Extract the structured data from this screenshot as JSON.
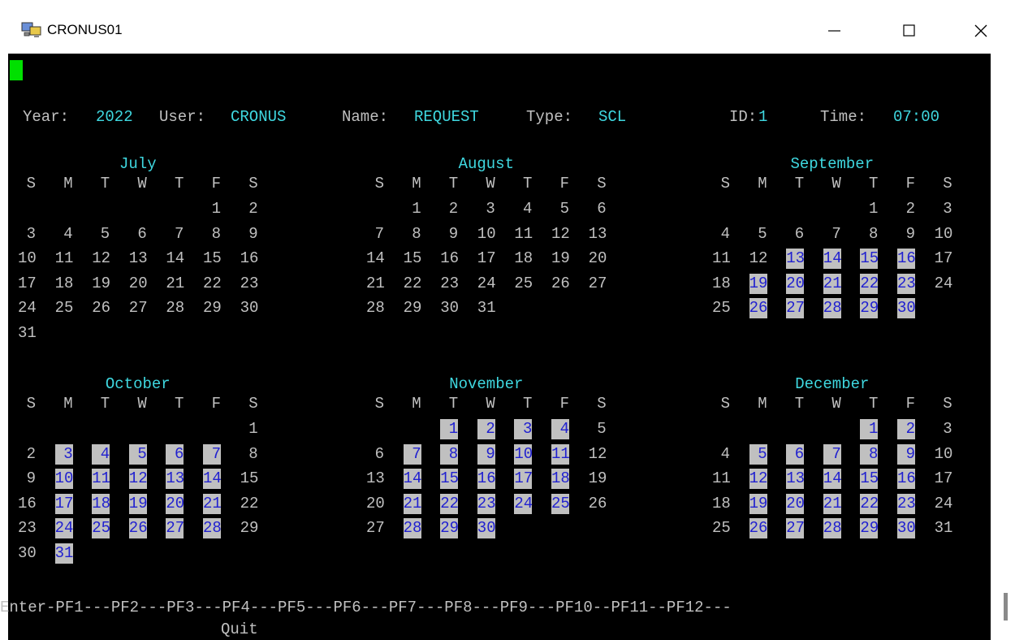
{
  "window": {
    "title": "CRONUS01"
  },
  "header": {
    "year_label": "Year:",
    "year": "2022",
    "user_label": "User:",
    "user": "CRONUS",
    "name_label": "Name:",
    "name": "REQUEST",
    "type_label": "Type:",
    "type": "SCL",
    "id_label": "ID:",
    "id": "1",
    "time_label": "Time:",
    "time": "07:00"
  },
  "weekdays": [
    "S",
    "M",
    "T",
    "W",
    "T",
    "F",
    "S"
  ],
  "months": [
    {
      "name": "July",
      "first_weekday": 5,
      "days": 31,
      "selected": []
    },
    {
      "name": "August",
      "first_weekday": 1,
      "days": 31,
      "selected": []
    },
    {
      "name": "September",
      "first_weekday": 4,
      "days": 30,
      "selected": [
        13,
        14,
        15,
        16,
        19,
        20,
        21,
        22,
        23,
        26,
        27,
        28,
        29,
        30
      ]
    },
    {
      "name": "October",
      "first_weekday": 6,
      "days": 31,
      "selected": [
        3,
        4,
        5,
        6,
        7,
        10,
        11,
        12,
        13,
        14,
        17,
        18,
        19,
        20,
        21,
        24,
        25,
        26,
        27,
        28,
        31
      ]
    },
    {
      "name": "November",
      "first_weekday": 2,
      "days": 30,
      "selected": [
        1,
        2,
        3,
        4,
        7,
        8,
        9,
        10,
        11,
        14,
        15,
        16,
        17,
        18,
        21,
        22,
        23,
        24,
        25,
        28,
        29,
        30
      ]
    },
    {
      "name": "December",
      "first_weekday": 4,
      "days": 31,
      "selected": [
        1,
        2,
        5,
        6,
        7,
        8,
        9,
        12,
        13,
        14,
        15,
        16,
        19,
        20,
        21,
        22,
        23,
        26,
        27,
        28,
        29,
        30
      ]
    }
  ],
  "footer": {
    "pf_keys": "Enter-PF1---PF2---PF3---PF4---PF5---PF6---PF7---PF8---PF9---PF10--PF11--PF12---",
    "pf3_label": "Quit"
  }
}
